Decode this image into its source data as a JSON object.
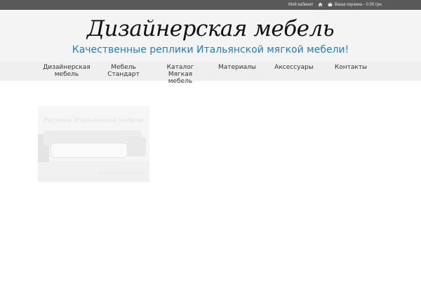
{
  "topbar": {
    "account": "Мой кабинет",
    "home_icon": "home-icon",
    "basket_icon": "basket-icon",
    "basket": "Ваша корзина - 0.00 грн."
  },
  "header": {
    "logo": "Дизайнерская мебель",
    "tagline": "Качественные реплики Итальянской мягкой мебели!"
  },
  "nav": {
    "items": [
      {
        "line1": "Дизайнерская",
        "line2": "мебель"
      },
      {
        "line1": "Мебель Стандарт",
        "line2": ""
      },
      {
        "line1": "Каталог Мягкая",
        "line2": "мебель"
      },
      {
        "line1": "Материалы",
        "line2": ""
      },
      {
        "line1": "Аксессуары",
        "line2": ""
      },
      {
        "line1": "Контакты",
        "line2": ""
      }
    ]
  },
  "banner": {
    "title": "Реплики Итальянской мебели",
    "subtitle": "Дизайнерская мебель"
  },
  "colors": {
    "topbar_bg": "#595959",
    "header_bg": "#f4f4f4",
    "nav_bg": "#efefef",
    "tagline": "#2b7ab4"
  }
}
